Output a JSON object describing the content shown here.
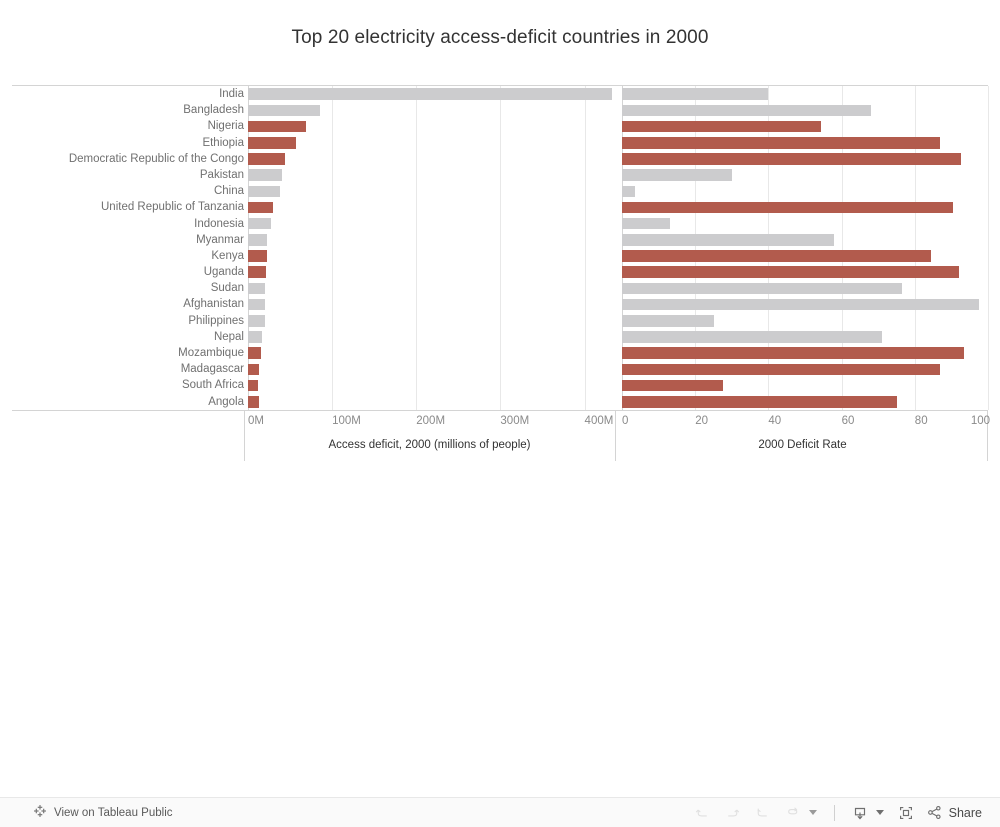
{
  "title": "Top 20 electricity access-deficit countries in 2000",
  "chart_data": {
    "type": "bar",
    "title": "Top 20 electricity access-deficit countries in 2000",
    "orientation": "horizontal",
    "categories": [
      "India",
      "Bangladesh",
      "Nigeria",
      "Ethiopia",
      "Democratic Republic of the Congo",
      "Pakistan",
      "China",
      "United Republic of Tanzania",
      "Indonesia",
      "Myanmar",
      "Kenya",
      "Uganda",
      "Sudan",
      "Afghanistan",
      "Philippines",
      "Nepal",
      "Mozambique",
      "Madagascar",
      "South Africa",
      "Angola"
    ],
    "panels": [
      {
        "name": "access-deficit",
        "xlabel": "Access deficit, 2000 (millions of people)",
        "ticks": [
          "0M",
          "100M",
          "200M",
          "300M",
          "400M"
        ],
        "tick_values": [
          0,
          100,
          200,
          300,
          400
        ],
        "xlim": [
          0,
          435
        ],
        "unit": "millions of people",
        "values": [
          433,
          85,
          69,
          57,
          44,
          41,
          38,
          30,
          27,
          23,
          22,
          21,
          20,
          20,
          20,
          17,
          16,
          13,
          12,
          13
        ]
      },
      {
        "name": "deficit-rate",
        "xlabel": "2000 Deficit Rate",
        "ticks": [
          "0",
          "20",
          "40",
          "60",
          "80",
          "100"
        ],
        "tick_values": [
          0,
          20,
          40,
          60,
          80,
          100
        ],
        "xlim": [
          0,
          100
        ],
        "unit": "percent",
        "values": [
          40,
          68,
          54.5,
          87,
          92.5,
          30,
          3.5,
          90.5,
          13,
          58,
          84.5,
          92,
          76.5,
          97.5,
          25,
          71,
          93.5,
          87,
          27.5,
          75
        ]
      }
    ],
    "colors": {
      "grey": "#ccccce",
      "red": "#b25b4d"
    },
    "color_rule": {
      "red": "high deficit rate",
      "grey": "lower deficit rate"
    },
    "bar_colors": [
      "grey",
      "grey",
      "red",
      "red",
      "red",
      "grey",
      "grey",
      "red",
      "grey",
      "grey",
      "red",
      "red",
      "grey",
      "grey",
      "grey",
      "grey",
      "red",
      "red",
      "red",
      "red"
    ],
    "grid": true,
    "legend": "none"
  },
  "toolbar": {
    "tableau_public_label": "View on Tableau Public",
    "tableau_icon": "tableau-logo-icon",
    "undo_label": "Undo",
    "redo_label": "Redo",
    "reset_label": "Reset",
    "refresh_label": "Refresh",
    "refresh_caret_label": "Refresh options",
    "download_label": "Download",
    "download_caret_label": "Download options",
    "fullscreen_label": "Full Screen",
    "share_label": "Share"
  }
}
